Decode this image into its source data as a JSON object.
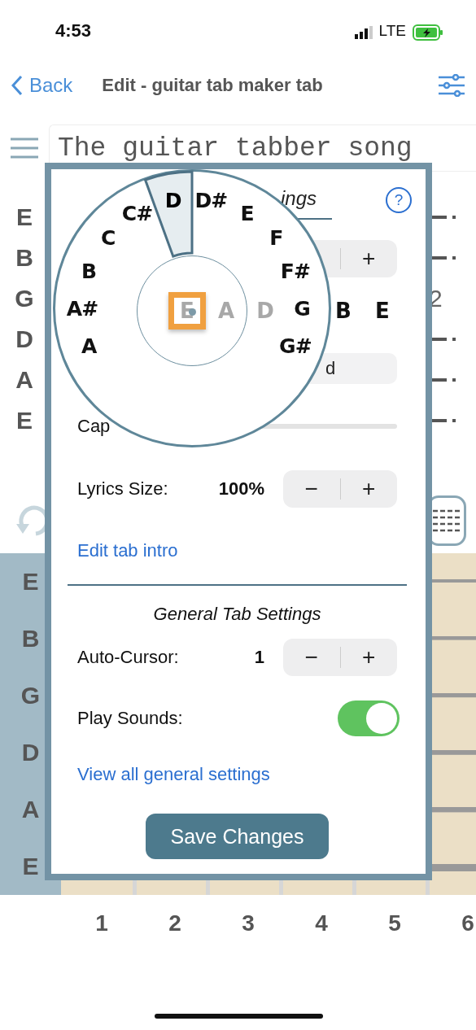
{
  "status_bar": {
    "time": "4:53",
    "network": "LTE"
  },
  "nav": {
    "back": "Back",
    "title": "Edit - guitar tab maker tab"
  },
  "song_title": {
    "value": "The guitar tabber song"
  },
  "tab_strings": [
    "E",
    "B",
    "G",
    "D",
    "A",
    "E"
  ],
  "tab_digit": "2",
  "modal": {
    "title": "ings",
    "help": "?",
    "string_count": {
      "plus": "+"
    },
    "tuning": {
      "value": "d"
    },
    "capo": {
      "label": "Cap"
    },
    "lyrics_size": {
      "label": "Lyrics Size:",
      "value": "100%",
      "minus": "−",
      "plus": "+"
    },
    "edit_intro_link": "Edit tab intro",
    "general_title": "General Tab Settings",
    "auto_cursor": {
      "label": "Auto-Cursor:",
      "value": "1",
      "minus": "−",
      "plus": "+"
    },
    "play_sounds": {
      "label": "Play Sounds:",
      "on": true
    },
    "general_link": "View all general settings",
    "save_button": "Save Changes"
  },
  "note_wheel": {
    "left_notes": [
      {
        "label": "C#",
        "selected": false
      },
      {
        "label": "C",
        "selected": false
      },
      {
        "label": "B",
        "selected": false
      },
      {
        "label": "A#",
        "selected": false
      },
      {
        "label": "A",
        "selected": false
      }
    ],
    "right_notes": [
      {
        "label": "D",
        "selected": true
      },
      {
        "label": "D#",
        "selected": false
      },
      {
        "label": "E",
        "selected": false
      },
      {
        "label": "F",
        "selected": false
      },
      {
        "label": "F#",
        "selected": false
      },
      {
        "label": "G",
        "selected": false
      },
      {
        "label": "G#",
        "selected": false
      }
    ],
    "strings": [
      {
        "label": "E",
        "selected": true,
        "faded": true
      },
      {
        "label": "A",
        "selected": false,
        "faded": true
      },
      {
        "label": "D",
        "selected": false,
        "faded": true
      },
      {
        "label": "B",
        "selected": false,
        "faded": false
      },
      {
        "label": "E",
        "selected": false,
        "faded": false
      }
    ]
  },
  "fretboard": {
    "strings": [
      "E",
      "B",
      "G",
      "D",
      "A",
      "E"
    ],
    "fret_numbers": [
      "1",
      "2",
      "3",
      "4",
      "5",
      "6"
    ]
  }
}
